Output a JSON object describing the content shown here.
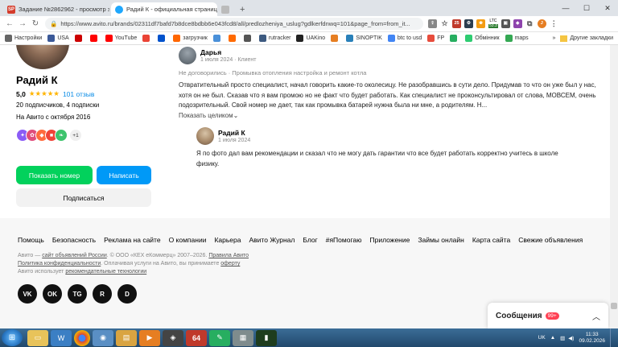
{
  "browser": {
    "tabs": [
      {
        "title": "Задание №2862962 - просмотр з",
        "icon_text": "SP",
        "color": "#d43c2c"
      },
      {
        "title": "Радий К - официальная страниц",
        "icon_text": "",
        "color": "#1ea7fd"
      },
      {
        "title": "",
        "icon_text": "",
        "color": "#888888"
      }
    ],
    "new_tab_label": "+",
    "url": "https://www.avito.ru/brands/02311df7bafd7b8dce8bdbb6e043fcd8/all/predlozheniya_uslug?gdlkerfdnwq=101&page_from=from_it...",
    "ext_ltc_label": "LTC",
    "ext_ltc_value": "53.3",
    "bookmarks": [
      {
        "label": "Настройки",
        "color": "#666666"
      },
      {
        "label": "USA",
        "color": "#3b5998"
      },
      {
        "label": "",
        "color": "#cc0000"
      },
      {
        "label": "",
        "color": "#ff0000"
      },
      {
        "label": "YouTube",
        "color": "#ff0000"
      },
      {
        "label": "",
        "color": "#ea4335"
      },
      {
        "label": "",
        "color": "#0052cc"
      },
      {
        "label": "загрузчик",
        "color": "#ff6600"
      },
      {
        "label": "",
        "color": "#4a90d9"
      },
      {
        "label": "",
        "color": "#ff6a00"
      },
      {
        "label": "",
        "color": "#555555"
      },
      {
        "label": "rutracker",
        "color": "#3d5a80"
      },
      {
        "label": "UAKino",
        "color": "#222222"
      },
      {
        "label": "",
        "color": "#e67e22"
      },
      {
        "label": "SINOPTIK",
        "color": "#2980b9"
      },
      {
        "label": "btc to usd",
        "color": "#4285f4"
      },
      {
        "label": "FP",
        "color": "#e74c3c"
      },
      {
        "label": "",
        "color": "#27ae60"
      },
      {
        "label": "Обмінник",
        "color": "#2ecc71"
      },
      {
        "label": "maps",
        "color": "#34a853"
      }
    ],
    "other_bookmarks": "Другие закладки"
  },
  "profile": {
    "name": "Радий К",
    "rating": "5,0",
    "stars": "★★★★★",
    "reviews": "101 отзыв",
    "subscribers": "20 подписчиков, 4 подписки",
    "since": "На Авито с октября 2016",
    "badges_more": "+1",
    "show_number": "Показать номер",
    "write": "Написать",
    "subscribe": "Подписаться"
  },
  "review": {
    "author": "Дарья",
    "meta": "1 июля 2024 · Клиент",
    "deal": "Не договорились · Промывка отопления настройка и ремонт котла",
    "text": "Отвратительный просто специалист, начал говорить какие-то околесицу. Не разобравшись в сути дело. Придумав то что он уже был у нас, хотя он не был. Сказав что я вам промою но не факт что будет работать. Как специалист не проконсультировал от слова, МОВСЕМ, очень подозрительный. Свой номер не дает, так как промывка батарей нужна была ни мне, а родителям. Н...",
    "show_more": "Показать целиком⌄",
    "answer_author": "Радий К",
    "answer_date": "1 июля 2024",
    "answer_text": "Я по фото дал вам рекомендации и сказал что не могу дать гарантии что все будет работать корректно учитесь в школе физику."
  },
  "footer": {
    "links": [
      "Помощь",
      "Безопасность",
      "Реклама на сайте",
      "О компании",
      "Карьера",
      "Авито Журнал",
      "Блог",
      "#яПомогаю",
      "Приложение",
      "Займы онлайн",
      "Карта сайта",
      "Свежие объявления"
    ],
    "copy_line1_prefix": "Авито — ",
    "copy_link1": "сайт объявлений России",
    "copy_line1_mid": ". © ООО «КЕХ еКоммерц» 2007–2026. ",
    "copy_link2": "Правила Авито",
    "copy_link3": "Политика конфиденциальности",
    "copy_line2_mid": ". Оплачивая услуги на Авито, вы принимаете ",
    "copy_link4": "оферту",
    "copy_line3_prefix": "Авито использует ",
    "copy_link5": "рекомендательные технологии",
    "social": [
      "VK",
      "OK",
      "TG",
      "R",
      "D"
    ]
  },
  "messages": {
    "label": "Сообщения",
    "count": "99+"
  },
  "taskbar": {
    "lang": "UK",
    "time": "11:33",
    "date": "09.02.2026",
    "app64": "64"
  }
}
